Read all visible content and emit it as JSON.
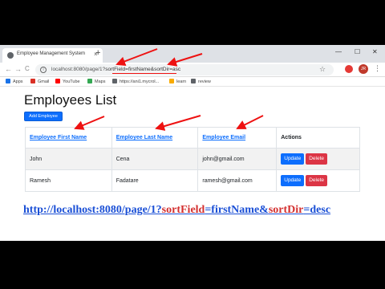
{
  "browser": {
    "tab_title": "Employee Management System",
    "tab_close": "×",
    "new_tab": "+",
    "minimize": "—",
    "maximize": "☐",
    "close": "✕",
    "back": "←",
    "forward": "→",
    "reload": "C",
    "url_base": "localhost:8080/page/1?",
    "url_query": "sortField=firstName&sortDir=asc",
    "star": "☆",
    "avatar": "JR",
    "menu": "⋮"
  },
  "bookmarks": [
    {
      "label": "Apps",
      "color": "#1a73e8"
    },
    {
      "label": "Gmail",
      "color": "#d93025"
    },
    {
      "label": "YouTube",
      "color": "#ff0000"
    },
    {
      "label": "Maps",
      "color": "#34a853"
    },
    {
      "label": "https://ani1.mycrol...",
      "color": "#5f6368"
    },
    {
      "label": "learn",
      "color": "#f9ab00"
    },
    {
      "label": "review",
      "color": "#5f6368"
    }
  ],
  "page": {
    "title": "Employees List",
    "add_button": "Add Employee",
    "headers": [
      "Employee First Name",
      "Employee Last Name",
      "Employee Email",
      "Actions"
    ],
    "rows": [
      {
        "first": "John",
        "last": "Cena",
        "email": "john@gmail.com"
      },
      {
        "first": "Ramesh",
        "last": "Fadatare",
        "email": "ramesh@gmail.com"
      }
    ],
    "update_label": "Update",
    "delete_label": "Delete"
  },
  "caption": {
    "part1": "http://localhost:8080/page/1?",
    "part2": "sortField",
    "part3": "=firstName&",
    "part4": "sortDir",
    "part5": "=desc"
  },
  "colors": {
    "primary": "#0d6efd",
    "danger": "#dc3545",
    "annotation": "#e11"
  }
}
